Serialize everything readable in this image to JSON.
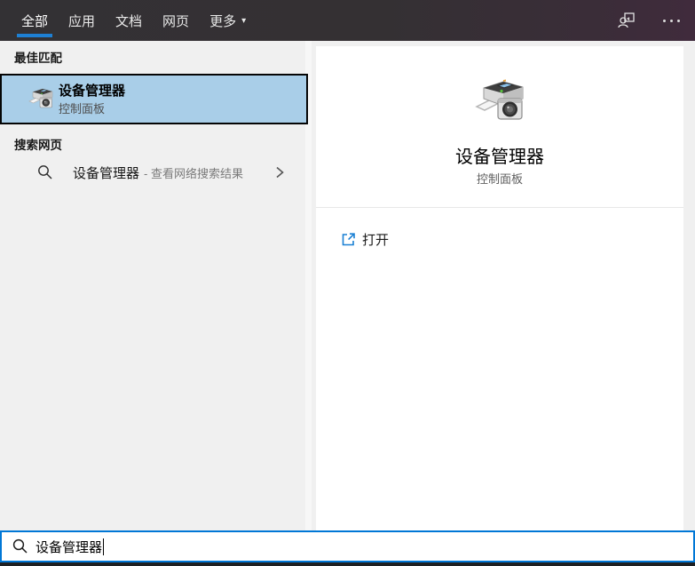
{
  "tabs": [
    {
      "label": "全部",
      "active": true
    },
    {
      "label": "应用",
      "active": false
    },
    {
      "label": "文档",
      "active": false
    },
    {
      "label": "网页",
      "active": false
    },
    {
      "label": "更多",
      "active": false,
      "has_dropdown": true
    }
  ],
  "icons": {
    "dropdown_arrow": "▾"
  },
  "left": {
    "best_match_header": "最佳匹配",
    "best_match": {
      "title": "设备管理器",
      "subtitle": "控制面板"
    },
    "web_header": "搜索网页",
    "web_suggestion": {
      "query": "设备管理器",
      "hint": "- 查看网络搜索结果"
    }
  },
  "preview": {
    "title": "设备管理器",
    "subtitle": "控制面板",
    "open_label": "打开"
  },
  "search": {
    "value": "设备管理器"
  },
  "colors": {
    "accent": "#0077d6",
    "tab_underline": "#1e80d4",
    "highlight_fill": "#a9cee8",
    "highlight_border": "#050505",
    "topbar": "#343033",
    "panel_bg": "#f0f0f0"
  }
}
